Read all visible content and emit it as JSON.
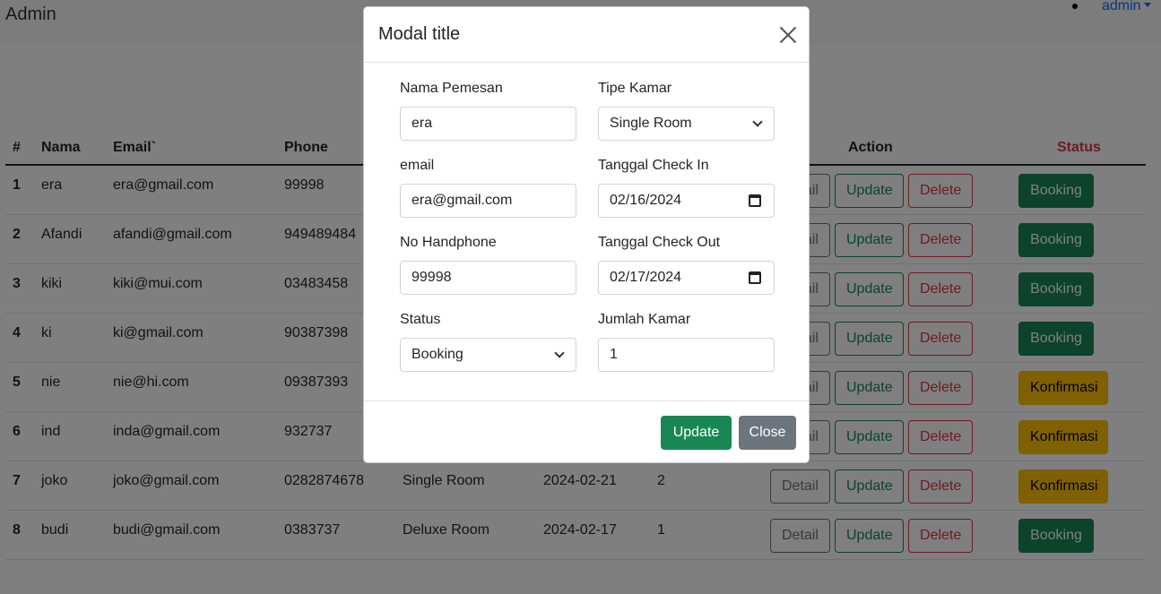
{
  "navbar": {
    "brand": "Admin",
    "user": "admin"
  },
  "table": {
    "headers": {
      "no": "#",
      "nama": "Nama",
      "email": "Email`",
      "phone": "Phone",
      "action": "Action",
      "status": "Status"
    },
    "status_header_color": "#dc3545",
    "rows": [
      {
        "no": "1",
        "nama": "era",
        "email": "era@gmail.com",
        "phone": "99998",
        "tipe": "",
        "tanggal": "",
        "jumlah": "",
        "status": "Booking"
      },
      {
        "no": "2",
        "nama": "Afandi",
        "email": "afandi@gmail.com",
        "phone": "949489484",
        "tipe": "",
        "tanggal": "",
        "jumlah": "",
        "status": "Booking"
      },
      {
        "no": "3",
        "nama": "kiki",
        "email": "kiki@mui.com",
        "phone": "03483458",
        "tipe": "",
        "tanggal": "",
        "jumlah": "",
        "status": "Booking"
      },
      {
        "no": "4",
        "nama": "ki",
        "email": "ki@gmail.com",
        "phone": "90387398",
        "tipe": "",
        "tanggal": "",
        "jumlah": "",
        "status": "Booking"
      },
      {
        "no": "5",
        "nama": "nie",
        "email": "nie@hi.com",
        "phone": "09387393",
        "tipe": "",
        "tanggal": "",
        "jumlah": "",
        "status": "Konfirmasi"
      },
      {
        "no": "6",
        "nama": "ind",
        "email": "inda@gmail.com",
        "phone": "932737",
        "tipe": "",
        "tanggal": "",
        "jumlah": "",
        "status": "Konfirmasi"
      },
      {
        "no": "7",
        "nama": "joko",
        "email": "joko@gmail.com",
        "phone": "0282874678",
        "tipe": "Single Room",
        "tanggal": "2024-02-21",
        "jumlah": "2",
        "status": "Konfirmasi"
      },
      {
        "no": "8",
        "nama": "budi",
        "email": "budi@gmail.com",
        "phone": "0383737",
        "tipe": "Deluxe Room",
        "tanggal": "2024-02-17",
        "jumlah": "1",
        "status": "Booking"
      }
    ],
    "buttons": {
      "detail": "Detail",
      "update": "Update",
      "delete": "Delete"
    }
  },
  "modal": {
    "title": "Modal title",
    "fields": {
      "nama": {
        "label": "Nama Pemesan",
        "value": "era"
      },
      "tipe": {
        "label": "Tipe Kamar",
        "value": "Single Room"
      },
      "email": {
        "label": "email",
        "value": "era@gmail.com"
      },
      "checkin": {
        "label": "Tanggal Check In",
        "value": "02/16/2024"
      },
      "phone": {
        "label": "No Handphone",
        "value": "99998"
      },
      "checkout": {
        "label": "Tanggal Check Out",
        "value": "02/17/2024"
      },
      "status": {
        "label": "Status",
        "value": "Booking"
      },
      "jumlah": {
        "label": "Jumlah Kamar",
        "value": "1"
      }
    },
    "buttons": {
      "update": "Update",
      "close": "Close"
    }
  },
  "colors": {
    "primary_link": "#0d6efd",
    "success": "#198754",
    "danger": "#dc3545",
    "warning": "#ffc107",
    "secondary": "#6c757d"
  },
  "icons": [
    "close-icon",
    "chevron-down-icon",
    "calendar-icon"
  ]
}
